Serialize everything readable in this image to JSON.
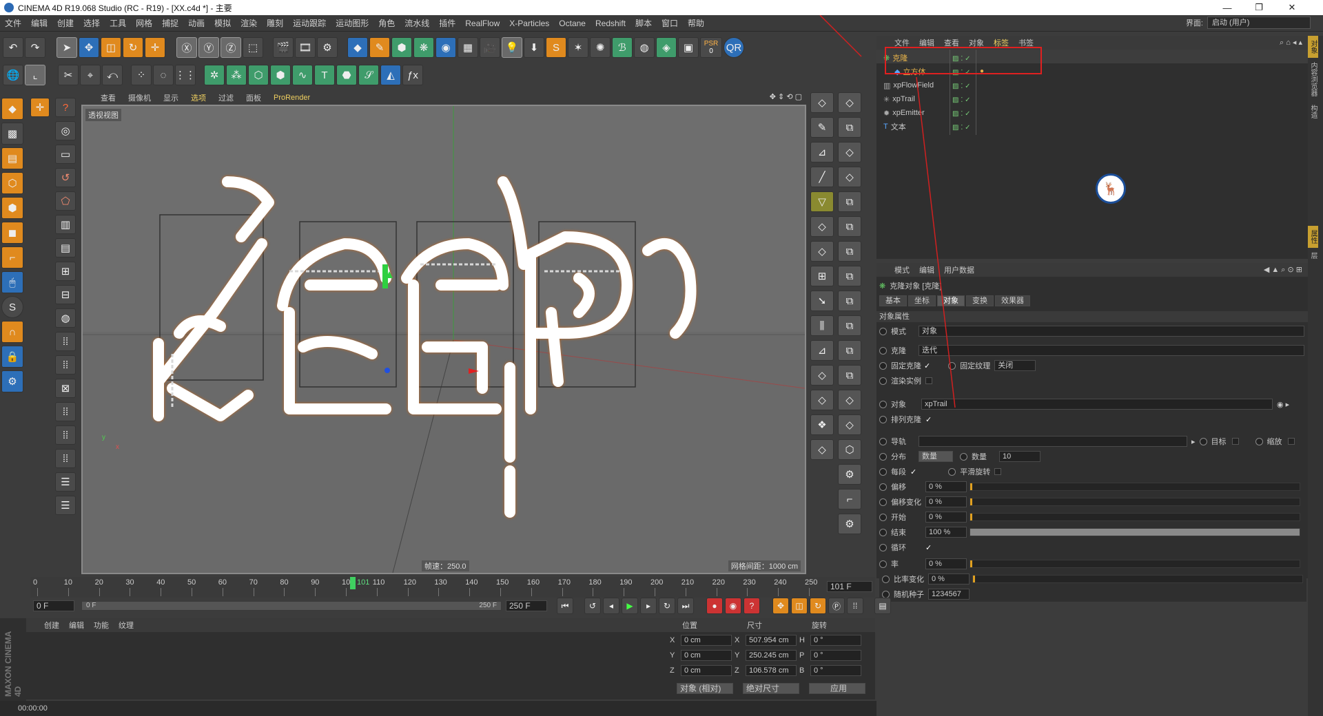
{
  "window": {
    "title": "CINEMA 4D R19.068 Studio (RC - R19) - [XX.c4d *] - 主要",
    "minimize": "—",
    "maximize": "❐",
    "close": "✕"
  },
  "menu": [
    "文件",
    "编辑",
    "创建",
    "选择",
    "工具",
    "网格",
    "捕捉",
    "动画",
    "模拟",
    "渲染",
    "雕刻",
    "运动跟踪",
    "运动图形",
    "角色",
    "流水线",
    "插件",
    "RealFlow",
    "X-Particles",
    "Octane",
    "Redshift",
    "脚本",
    "窗口",
    "帮助"
  ],
  "interface": {
    "label": "界面:",
    "value": "启动 (用户)"
  },
  "psr": {
    "label": "PSR",
    "value": "0"
  },
  "viewport": {
    "menu": [
      "查看",
      "摄像机",
      "显示",
      "选项",
      "过滤",
      "面板",
      "ProRender"
    ],
    "label": "透视视图",
    "speed": "帧速：250.0",
    "grid": "网格间距：1000 cm",
    "axis_y": "y",
    "axis_x": "x"
  },
  "object_manager": {
    "menu": [
      "文件",
      "编辑",
      "查看",
      "对象",
      "标签",
      "书签"
    ],
    "objects": [
      {
        "name": "克隆",
        "color": "#e6b24a"
      },
      {
        "name": "立方体",
        "color": "#e6b24a"
      },
      {
        "name": "xpFlowField",
        "color": "#cfcfcf"
      },
      {
        "name": "xpTrail",
        "color": "#cfcfcf"
      },
      {
        "name": "xpEmitter",
        "color": "#cfcfcf"
      },
      {
        "name": "文本",
        "color": "#cfcfcf"
      }
    ]
  },
  "attributes": {
    "menu": [
      "模式",
      "编辑",
      "用户数据"
    ],
    "title": "克隆对象 [克隆]",
    "tabs": [
      "基本",
      "坐标",
      "对象",
      "变换",
      "效果器"
    ],
    "section": "对象属性",
    "mode_label": "模式",
    "mode_value": "对象",
    "clone_label": "克隆",
    "clone_value": "迭代",
    "fix_clone": "固定克隆",
    "fix_texture": "固定纹理",
    "fix_texture_value": "关闭",
    "render_instances": "渲染实例",
    "object_label": "对象",
    "object_value": "xpTrail",
    "align_clone": "排列克隆",
    "rail_label": "导轨",
    "target": "目标",
    "scale": "缩放",
    "dist_label": "分布",
    "dist_value": "数量",
    "count_label": "数量",
    "count_value": "10",
    "per_seg": "每段",
    "smooth_rot": "平滑旋转",
    "offset": "偏移",
    "offset_value": "0 %",
    "offset_var": "偏移变化",
    "offset_var_value": "0 %",
    "start": "开始",
    "start_value": "0 %",
    "end": "结束",
    "end_value": "100 %",
    "loop": "循环",
    "rate": "率",
    "rate_value": "0 %",
    "rate_var": "比率变化",
    "rate_var_value": "0 %",
    "seed": "随机种子",
    "seed_value": "1234567"
  },
  "timeline": {
    "ticks": [
      "0",
      "10",
      "20",
      "30",
      "40",
      "50",
      "60",
      "70",
      "80",
      "90",
      "100",
      "110",
      "120",
      "130",
      "140",
      "150",
      "160",
      "170",
      "180",
      "190",
      "200",
      "210",
      "220",
      "230",
      "240",
      "250"
    ],
    "current": "101",
    "current_field": "101 F",
    "start_field": "0 F",
    "range_start": "0 F",
    "range_end": "250 F",
    "end_field": "250 F"
  },
  "materials": {
    "menu": [
      "创建",
      "编辑",
      "功能",
      "纹理"
    ]
  },
  "coords": {
    "headers": [
      "位置",
      "尺寸",
      "旋转"
    ],
    "rows": [
      {
        "axis": "X",
        "pos": "0 cm",
        "size_axis": "X",
        "size": "507.954 cm",
        "rot_axis": "H",
        "rot": "0 °"
      },
      {
        "axis": "Y",
        "pos": "0 cm",
        "size_axis": "Y",
        "size": "250.245 cm",
        "rot_axis": "P",
        "rot": "0 °"
      },
      {
        "axis": "Z",
        "pos": "0 cm",
        "size_axis": "Z",
        "size": "106.578 cm",
        "rot_axis": "B",
        "rot": "0 °"
      }
    ],
    "mode1": "对象 (相对)",
    "mode2": "绝对尺寸",
    "apply": "应用"
  },
  "status": {
    "time": "00:00:00"
  },
  "brand": "MAXON CINEMA 4D",
  "right_tabs": [
    "对象",
    "内容浏览器",
    "构造",
    "属性",
    "层"
  ]
}
